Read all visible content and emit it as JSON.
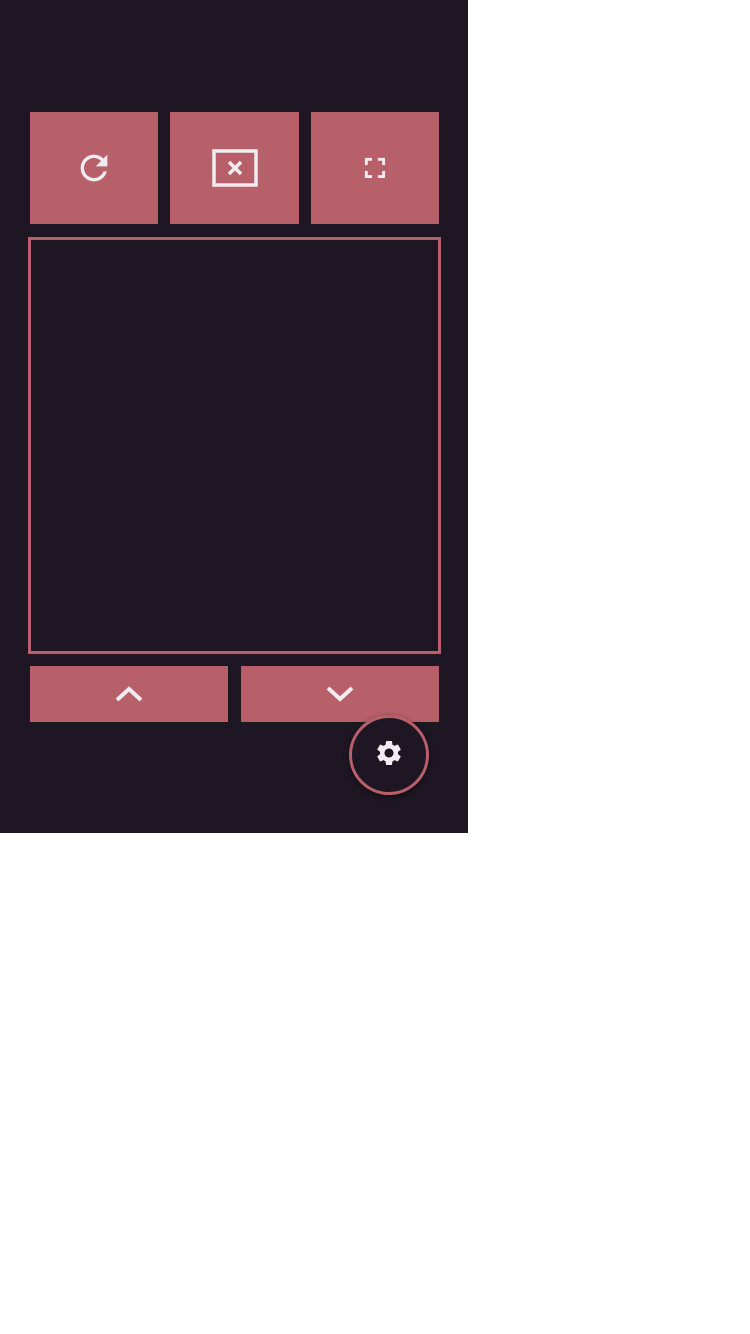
{
  "colors": {
    "background": "#1e1723",
    "accent": "#b8606a",
    "icon": "#f1ecf2",
    "page": "#ffffff"
  },
  "toolbar": {
    "buttons": [
      {
        "icon": "refresh-icon"
      },
      {
        "icon": "close-box-icon"
      },
      {
        "icon": "fullscreen-icon"
      }
    ]
  },
  "display_panel": {
    "content": ""
  },
  "navigation": {
    "up_icon": "chevron-up-icon",
    "down_icon": "chevron-down-icon"
  },
  "fab": {
    "icon": "gear-icon"
  }
}
